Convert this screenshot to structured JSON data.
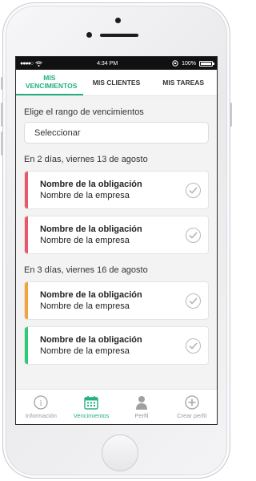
{
  "status_bar": {
    "signal": "●●●●○",
    "time": "4:34 PM",
    "battery": "100%"
  },
  "tabs": [
    {
      "label": "MIS VENCIMIENTOS",
      "active": true
    },
    {
      "label": "MIS CLIENTES",
      "active": false
    },
    {
      "label": "MIS TAREAS",
      "active": false
    }
  ],
  "range": {
    "label": "Elige el rango de vencimientos",
    "select_value": "Seleccionar"
  },
  "groups": [
    {
      "date": "En 2 días, viernes 13 de agosto",
      "items": [
        {
          "title": "Nombre de la obligación",
          "subtitle": "Nombre de la empresa",
          "color": "#e8586b"
        },
        {
          "title": "Nombre de la obligación",
          "subtitle": "Nombre de la empresa",
          "color": "#e8586b"
        }
      ]
    },
    {
      "date": "En 3 días, viernes 16 de agosto",
      "items": [
        {
          "title": "Nombre de la obligación",
          "subtitle": "Nombre de la empresa",
          "color": "#f3a33a"
        },
        {
          "title": "Nombre de la obligación",
          "subtitle": "Nombre de la empresa",
          "color": "#2ccb75"
        }
      ]
    }
  ],
  "bottom_nav": [
    {
      "label": "Información",
      "icon": "info-icon",
      "active": false
    },
    {
      "label": "Vencimientos",
      "icon": "calendar-icon",
      "active": true
    },
    {
      "label": "Perfil",
      "icon": "user-icon",
      "active": false
    },
    {
      "label": "Crear perfil",
      "icon": "add-circle-icon",
      "active": false
    }
  ],
  "colors": {
    "accent": "#22b07d",
    "urgent": "#e8586b",
    "warning": "#f3a33a",
    "ok": "#2ccb75"
  }
}
